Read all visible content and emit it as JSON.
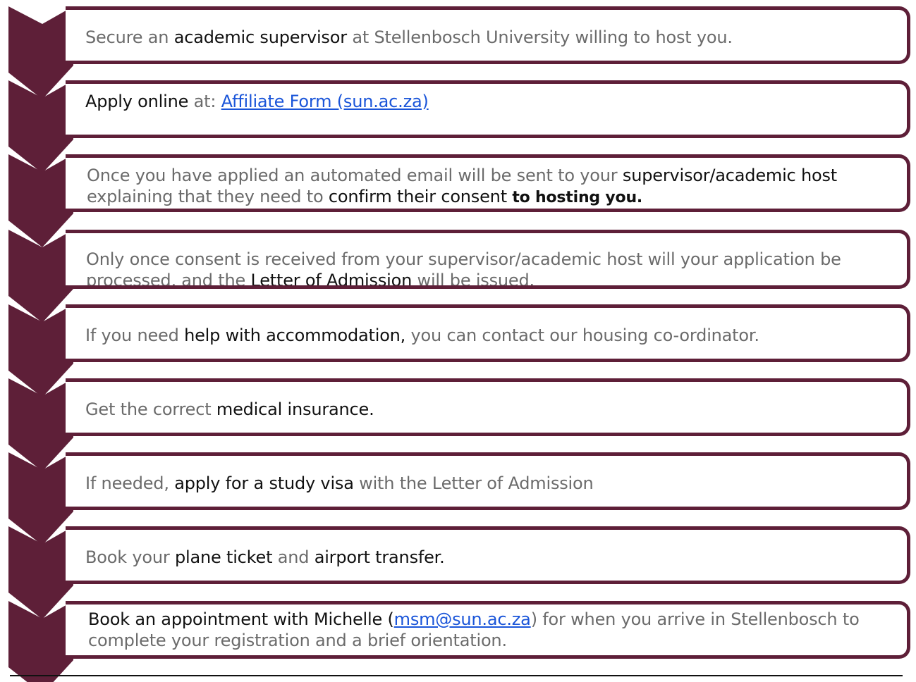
{
  "colors": {
    "accent": "#5e1f38",
    "text": "#6b6b6b",
    "emphasis": "#111111",
    "link": "#1a55d9"
  },
  "steps": [
    {
      "parts": [
        "Secure an ",
        "academic supervisor",
        " at Stellenbosch University willing to host you."
      ]
    },
    {
      "parts": [
        "Apply online",
        " at: ",
        "Affiliate Form (sun.ac.za)"
      ]
    },
    {
      "line1": [
        "Once you have applied an automated email will be sent to your ",
        "supervisor/academic host"
      ],
      "line2": [
        " explaining that they need to ",
        "confirm their consent ",
        "to hosting you."
      ]
    },
    {
      "line1": [
        "Only once consent is received from your supervisor/academic host will your application be"
      ],
      "line2": [
        " processed, and the ",
        "Letter of Admission",
        " will be issued."
      ]
    },
    {
      "parts": [
        "If you need ",
        "help with accommodation,",
        " you can contact our housing co-ordinator."
      ]
    },
    {
      "parts": [
        "Get the correct ",
        "medical insurance."
      ]
    },
    {
      "parts": [
        "If needed, ",
        "apply for a study visa",
        " with the Letter of Admission"
      ]
    },
    {
      "parts": [
        "Book your ",
        "plane ticket",
        " and ",
        "airport transfer."
      ]
    },
    {
      "line1": [
        "Book an appointment with Michelle (",
        "msm@sun.ac.za",
        ") for when you arrive in Stellenbosch to"
      ],
      "line2": [
        " complete your registration and a brief orientation."
      ]
    }
  ]
}
